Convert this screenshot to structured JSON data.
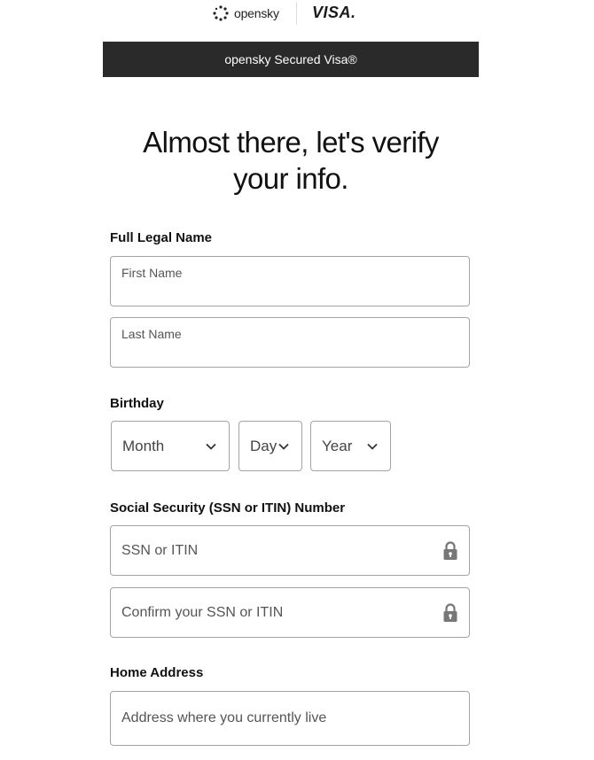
{
  "header": {
    "brand_name": "opensky",
    "partner_name": "VISA.",
    "product_banner": "opensky Secured Visa®"
  },
  "main": {
    "heading_line1": "Almost there, let's verify",
    "heading_line2": "your info.",
    "full_name": {
      "label": "Full Legal Name",
      "first_placeholder": "First Name",
      "last_placeholder": "Last Name"
    },
    "birthday": {
      "label": "Birthday",
      "month": "Month",
      "day": "Day",
      "year": "Year"
    },
    "ssn": {
      "label": "Social Security (SSN or ITIN) Number",
      "placeholder": "SSN or ITIN",
      "confirm_placeholder": "Confirm your SSN or ITIN"
    },
    "address": {
      "label": "Home Address",
      "placeholder": "Address where you currently live"
    }
  },
  "icons": {
    "brand_logo": "opensky-logo-icon",
    "lock": "lock-icon",
    "chevron": "chevron-down-icon"
  },
  "colors": {
    "banner_bg": "#2a2a2a",
    "banner_text": "#ffffff",
    "field_border": "#a3a3a3",
    "placeholder_text": "#555555"
  }
}
